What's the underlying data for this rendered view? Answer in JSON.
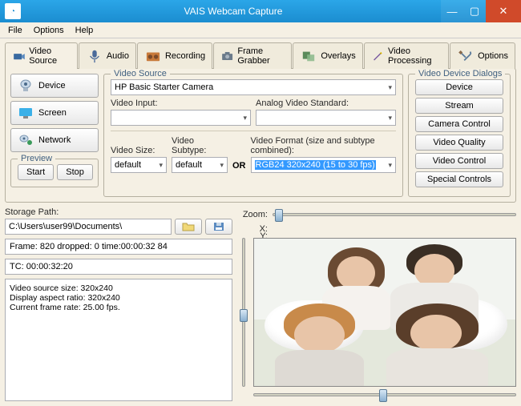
{
  "window": {
    "title": "VAIS Webcam Capture"
  },
  "menu": {
    "file": "File",
    "options": "Options",
    "help": "Help"
  },
  "tabs": {
    "video_source": "Video Source",
    "audio": "Audio",
    "recording": "Recording",
    "frame_grabber": "Frame Grabber",
    "overlays": "Overlays",
    "video_processing": "Video Processing",
    "options": "Options"
  },
  "leftButtons": {
    "device": "Device",
    "screen": "Screen",
    "network": "Network"
  },
  "preview": {
    "legend": "Preview",
    "start": "Start",
    "stop": "Stop"
  },
  "videoSource": {
    "legend": "Video Source",
    "camera": "HP Basic Starter Camera",
    "video_input_label": "Video Input:",
    "analog_label": "Analog Video Standard:",
    "video_size_label": "Video Size:",
    "video_subtype_label": "Video Subtype:",
    "size_value": "default",
    "subtype_value": "default",
    "or": "OR",
    "format_label": "Video Format (size and subtype combined):",
    "format_value": "RGB24 320x240 (15 to 30 fps)"
  },
  "deviceDialogs": {
    "legend": "Video Device Dialogs",
    "device": "Device",
    "stream": "Stream",
    "camera_control": "Camera Control",
    "video_quality": "Video Quality",
    "video_control": "Video Control",
    "special_controls": "Special Controls"
  },
  "storage": {
    "label": "Storage Path:",
    "path": "C:\\Users\\user99\\Documents\\"
  },
  "status": {
    "line1": "Frame: 820 dropped: 0 time:00:00:32 84",
    "line2": "TC: 00:00:32:20"
  },
  "log": "Video source size: 320x240\nDisplay aspect ratio: 320x240\nCurrent frame rate: 25.00 fps.",
  "labels": {
    "zoom": "Zoom:",
    "x": "X:",
    "y": "Y:"
  }
}
